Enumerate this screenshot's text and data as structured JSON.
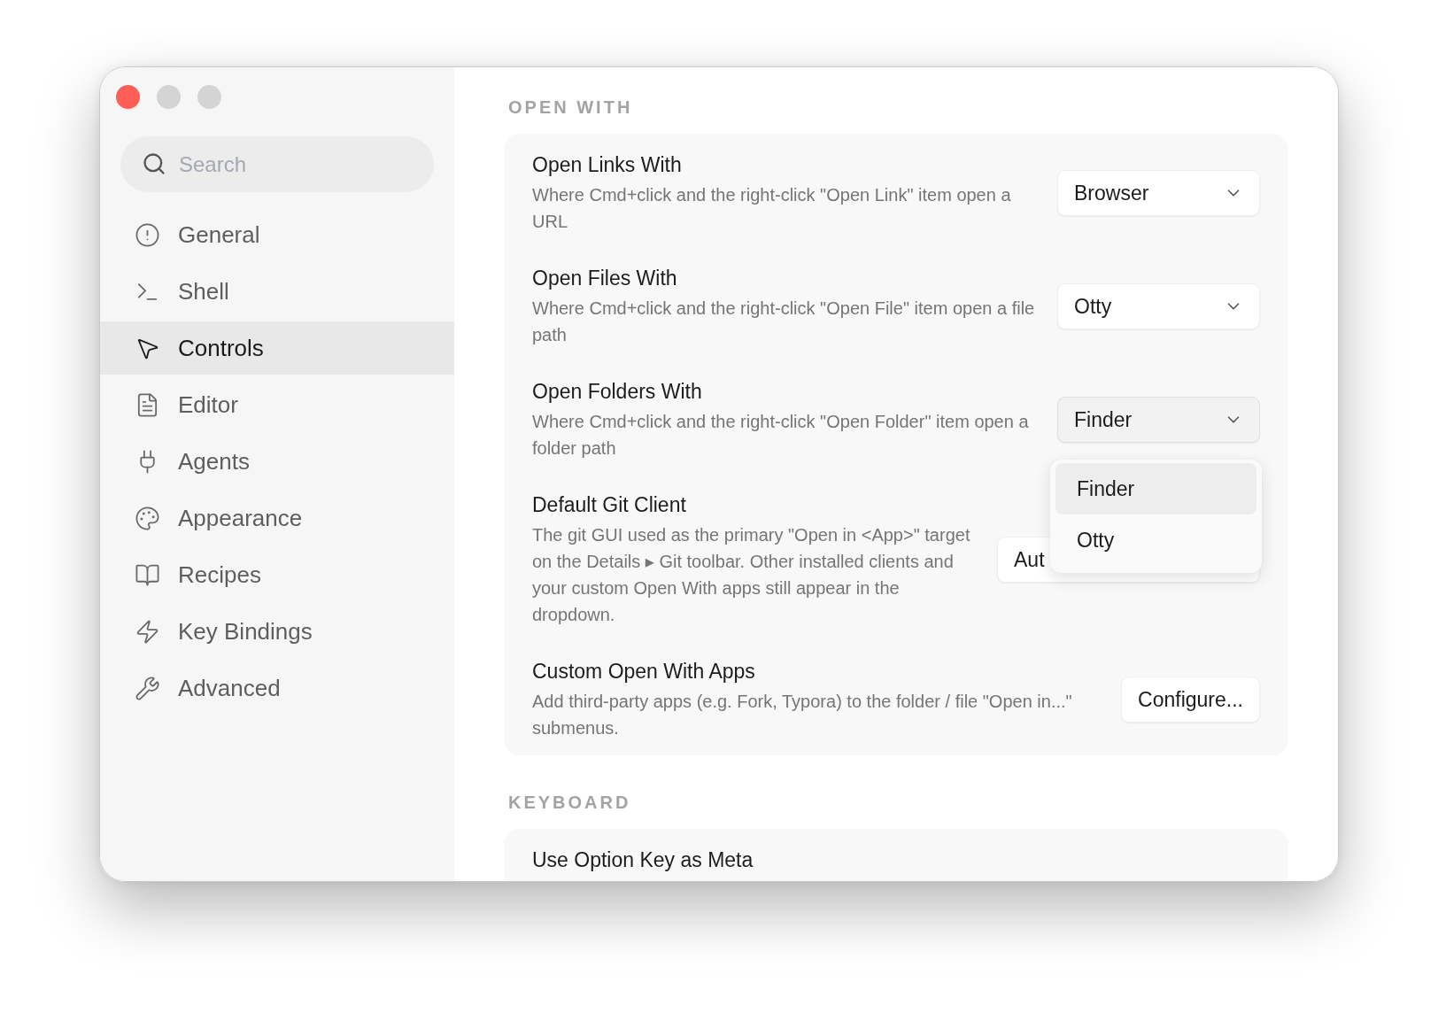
{
  "window": {
    "controls": [
      {
        "kind": "close"
      },
      {
        "kind": "minimize"
      },
      {
        "kind": "zoom"
      }
    ]
  },
  "sidebar": {
    "search": {
      "placeholder": "Search"
    },
    "items": [
      {
        "label": "General",
        "selected": false
      },
      {
        "label": "Shell",
        "selected": false
      },
      {
        "label": "Controls",
        "selected": true
      },
      {
        "label": "Editor",
        "selected": false
      },
      {
        "label": "Agents",
        "selected": false
      },
      {
        "label": "Appearance",
        "selected": false
      },
      {
        "label": "Recipes",
        "selected": false
      },
      {
        "label": "Key Bindings",
        "selected": false
      },
      {
        "label": "Advanced",
        "selected": false
      }
    ]
  },
  "sections": [
    {
      "title": "OPEN WITH",
      "rows": [
        {
          "title": "Open Links With",
          "description": "Where Cmd+click and the right-click \"Open Link\" item open a URL",
          "control": {
            "kind": "select",
            "value": "Browser",
            "open": false
          }
        },
        {
          "title": "Open Files With",
          "description": "Where Cmd+click and the right-click \"Open File\" item open a file path",
          "control": {
            "kind": "select",
            "value": "Otty",
            "open": false
          }
        },
        {
          "title": "Open Folders With",
          "description": "Where Cmd+click and the right-click \"Open Folder\" item open a folder path",
          "control": {
            "kind": "select",
            "value": "Finder",
            "open": true
          }
        },
        {
          "title": "Default Git Client",
          "description": "The git GUI used as the primary \"Open in <App>\" target on the Details ▸ Git toolbar. Other installed clients and your custom Open With apps still appear in the dropdown.",
          "control": {
            "kind": "select",
            "value": "Aut",
            "open": false,
            "covered": true
          }
        },
        {
          "title": "Custom Open With Apps",
          "description": "Add third-party apps (e.g. Fork, Typora) to the folder / file \"Open in...\" submenus.",
          "control": {
            "kind": "button",
            "label": "Configure..."
          }
        }
      ]
    },
    {
      "title": "KEYBOARD",
      "rows": [
        {
          "title": "Use Option Key as Meta"
        }
      ]
    }
  ],
  "dropdown_menu": {
    "options": [
      {
        "label": "Finder",
        "selected": true
      },
      {
        "label": "Otty",
        "selected": false
      }
    ]
  }
}
